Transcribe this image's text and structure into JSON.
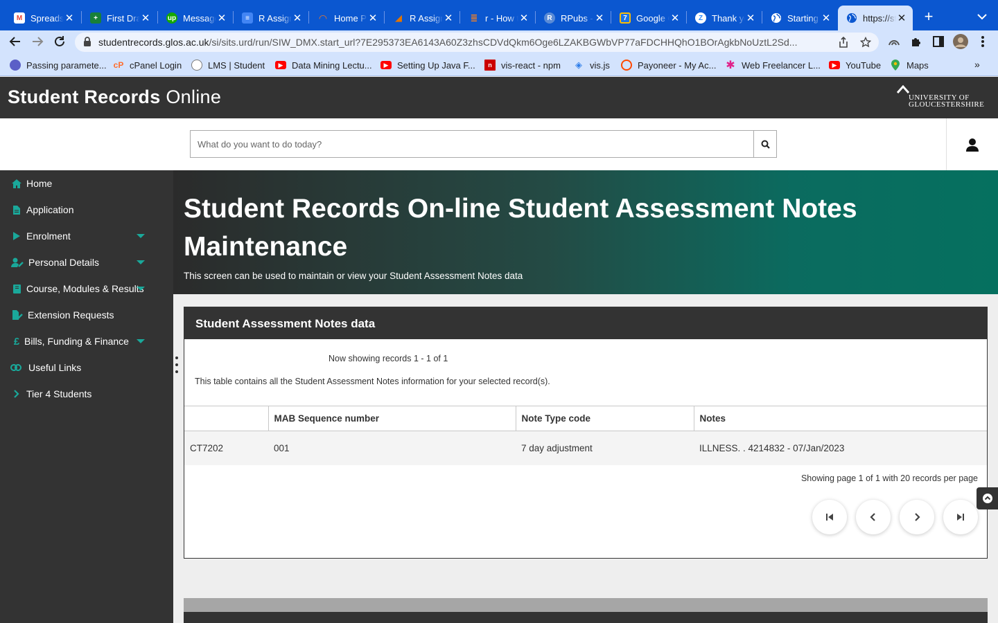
{
  "browser": {
    "tabs": [
      {
        "title": "Spreadsheet",
        "icon": "gmail-icon",
        "color": "#ea4335",
        "glyph": "M"
      },
      {
        "title": "First Draft",
        "icon": "sheets-icon",
        "color": "#188038",
        "glyph": "+"
      },
      {
        "title": "Messages",
        "icon": "upwork-icon",
        "color": "#14a800",
        "glyph": "up"
      },
      {
        "title": "R Assignment",
        "icon": "docs-icon",
        "color": "#4285f4",
        "glyph": "≡"
      },
      {
        "title": "Home Page",
        "icon": "jupyter-icon",
        "color": "#f37726",
        "glyph": "◠"
      },
      {
        "title": "R Assignment",
        "icon": "overleaf-icon",
        "color": "#e37400",
        "glyph": "◢"
      },
      {
        "title": "r - How to",
        "icon": "stackoverflow-icon",
        "color": "#f48024",
        "glyph": "≣"
      },
      {
        "title": "RPubs - ",
        "icon": "rpubs-icon",
        "color": "#5a8bd6",
        "glyph": "R"
      },
      {
        "title": "Google Calendar",
        "icon": "calendar-icon",
        "color": "#1a73e8",
        "glyph": "7"
      },
      {
        "title": "Thank you",
        "icon": "zoom-icon",
        "color": "#2d8cff",
        "glyph": "Z"
      },
      {
        "title": "Starting",
        "icon": "globe-icon",
        "color": "transparent",
        "glyph": "◉"
      },
      {
        "title": "https://studentrecords",
        "icon": "globe-icon",
        "color": "transparent",
        "glyph": "◉",
        "active": true
      }
    ],
    "url_host": "studentrecords.glos.ac.uk",
    "url_path": "/si/sits.urd/run/SIW_DMX.start_url?7E295373EA6143A60Z3zhsCDVdQkm6Oge6LZAKBGWbVP77aFDCHHQhO1BOrAgkbNoUztL2Sd...",
    "bookmarks": [
      {
        "label": "Passing paramete...",
        "icon": "bookmark-icon",
        "color": "#5b5fc7",
        "glyph": "◯"
      },
      {
        "label": "cPanel Login",
        "icon": "cpanel-icon",
        "color": "#ff6c2c",
        "glyph": "cP"
      },
      {
        "label": "LMS | Student",
        "icon": "lms-icon",
        "color": "#7a7a7a",
        "glyph": "◍"
      },
      {
        "label": "Data Mining Lectu...",
        "icon": "youtube-icon",
        "color": "#ff0000",
        "glyph": "▶"
      },
      {
        "label": "Setting Up Java F...",
        "icon": "youtube-icon",
        "color": "#ff0000",
        "glyph": "▶"
      },
      {
        "label": "vis-react - npm",
        "icon": "npm-icon",
        "color": "#cb0000",
        "glyph": "n"
      },
      {
        "label": "vis.js",
        "icon": "visjs-icon",
        "color": "#2b7ce9",
        "glyph": "◈"
      },
      {
        "label": "Payoneer - My Ac...",
        "icon": "payoneer-icon",
        "color": "#ff4800",
        "glyph": "◌"
      },
      {
        "label": "Web Freelancer L...",
        "icon": "freelancer-icon",
        "color": "#e0218a",
        "glyph": "✱"
      },
      {
        "label": "YouTube",
        "icon": "youtube-icon",
        "color": "#ff0000",
        "glyph": "▶"
      },
      {
        "label": "Maps",
        "icon": "maps-icon",
        "color": "#34a853",
        "glyph": "●"
      }
    ]
  },
  "site": {
    "title_bold": "Student Records",
    "title_light": " Online",
    "logo_line1": "UNIVERSITY OF",
    "logo_line2": "GLOUCESTERSHIRE",
    "search_placeholder": "What do you want to do today?"
  },
  "sidebar": {
    "items": [
      {
        "label": "Home",
        "icon": "home-icon",
        "has_caret": false
      },
      {
        "label": "Application",
        "icon": "document-icon",
        "has_caret": false
      },
      {
        "label": "Enrolment",
        "icon": "play-icon",
        "has_caret": true
      },
      {
        "label": "Personal Details",
        "icon": "user-edit-icon",
        "has_caret": true
      },
      {
        "label": "Course, Modules & Results",
        "icon": "book-icon",
        "has_caret": true
      },
      {
        "label": "Extension Requests",
        "icon": "file-edit-icon",
        "has_caret": false
      },
      {
        "label": "Bills, Funding & Finance",
        "icon": "pound-icon",
        "has_caret": true
      },
      {
        "label": "Useful Links",
        "icon": "link-icon",
        "has_caret": false
      },
      {
        "label": "Tier 4 Students",
        "icon": "chevron-right-icon",
        "has_caret": false
      }
    ]
  },
  "hero": {
    "title": "Student Records On-line Student Assessment Notes Maintenance",
    "subtitle": "This screen can be used to maintain or view your Student Assessment Notes data"
  },
  "panel": {
    "heading": "Student Assessment Notes data",
    "records_info": "Now showing records 1 - 1 of 1",
    "table_description": "This table contains all the Student Assessment Notes information for your selected record(s).",
    "columns": [
      "",
      "MAB Sequence number",
      "Note Type code",
      "Notes"
    ],
    "rows": [
      [
        "CT7202",
        "001",
        "7 day adjustment",
        "ILLNESS. . 4214832 - 07/Jan/2023"
      ]
    ],
    "pager_text": "Showing page 1 of 1 with 20 records per page"
  },
  "colors": {
    "accent": "#1aa89a",
    "dark": "#333333",
    "browser_blue": "#0b57d0"
  }
}
